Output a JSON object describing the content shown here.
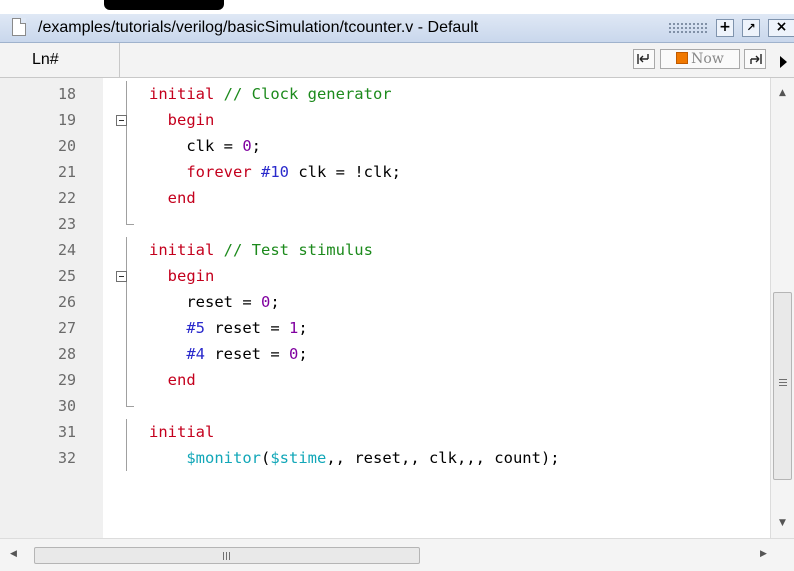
{
  "window": {
    "title": "/examples/tutorials/verilog/basicSimulation/tcounter.v - Default",
    "add_button": "+",
    "undock_button": "↗",
    "close_button": "×"
  },
  "header": {
    "line_number_column": "Ln#",
    "now_label": "Now",
    "prev_event_icon": "goto-previous-icon",
    "next_event_icon": "goto-next-icon"
  },
  "editor": {
    "lines": [
      {
        "num": "18",
        "fold": "none",
        "segments": [
          {
            "t": "initial",
            "c": "kw"
          },
          {
            "t": " // Clock generator",
            "c": "cm"
          }
        ]
      },
      {
        "num": "19",
        "fold": "box",
        "segments": [
          {
            "t": "  "
          },
          {
            "t": "begin",
            "c": "kw"
          }
        ]
      },
      {
        "num": "20",
        "fold": "line",
        "segments": [
          {
            "t": "    clk = "
          },
          {
            "t": "0",
            "c": "num"
          },
          {
            "t": ";"
          }
        ]
      },
      {
        "num": "21",
        "fold": "line",
        "segments": [
          {
            "t": "    "
          },
          {
            "t": "forever",
            "c": "kw"
          },
          {
            "t": " "
          },
          {
            "t": "#10",
            "c": "dl"
          },
          {
            "t": " clk = !clk;"
          }
        ]
      },
      {
        "num": "22",
        "fold": "line",
        "segments": [
          {
            "t": "  "
          },
          {
            "t": "end",
            "c": "kw"
          }
        ]
      },
      {
        "num": "23",
        "fold": "end",
        "segments": []
      },
      {
        "num": "24",
        "fold": "none",
        "segments": [
          {
            "t": "initial",
            "c": "kw"
          },
          {
            "t": " // Test stimulus",
            "c": "cm"
          }
        ]
      },
      {
        "num": "25",
        "fold": "box",
        "segments": [
          {
            "t": "  "
          },
          {
            "t": "begin",
            "c": "kw"
          }
        ]
      },
      {
        "num": "26",
        "fold": "line",
        "segments": [
          {
            "t": "    reset = "
          },
          {
            "t": "0",
            "c": "num"
          },
          {
            "t": ";"
          }
        ]
      },
      {
        "num": "27",
        "fold": "line",
        "segments": [
          {
            "t": "    "
          },
          {
            "t": "#5",
            "c": "dl"
          },
          {
            "t": " reset = "
          },
          {
            "t": "1",
            "c": "num"
          },
          {
            "t": ";"
          }
        ]
      },
      {
        "num": "28",
        "fold": "line",
        "segments": [
          {
            "t": "    "
          },
          {
            "t": "#4",
            "c": "dl"
          },
          {
            "t": " reset = "
          },
          {
            "t": "0",
            "c": "num"
          },
          {
            "t": ";"
          }
        ]
      },
      {
        "num": "29",
        "fold": "line",
        "segments": [
          {
            "t": "  "
          },
          {
            "t": "end",
            "c": "kw"
          }
        ]
      },
      {
        "num": "30",
        "fold": "end",
        "segments": []
      },
      {
        "num": "31",
        "fold": "none",
        "segments": [
          {
            "t": "initial",
            "c": "kw"
          }
        ]
      },
      {
        "num": "32",
        "fold": "line",
        "segments": [
          {
            "t": "    "
          },
          {
            "t": "$monitor",
            "c": "sys"
          },
          {
            "t": "("
          },
          {
            "t": "$stime",
            "c": "sys"
          },
          {
            "t": ",, reset,, clk,,, count);"
          }
        ]
      }
    ]
  },
  "scrollbars": {
    "horizontal_grip": "III"
  },
  "colors": {
    "keyword": "#c4001d",
    "comment": "#1c8a1c",
    "number": "#8000a0",
    "system_task": "#12a7b8",
    "delay": "#2a2acc",
    "now_marker": "#f07800"
  }
}
